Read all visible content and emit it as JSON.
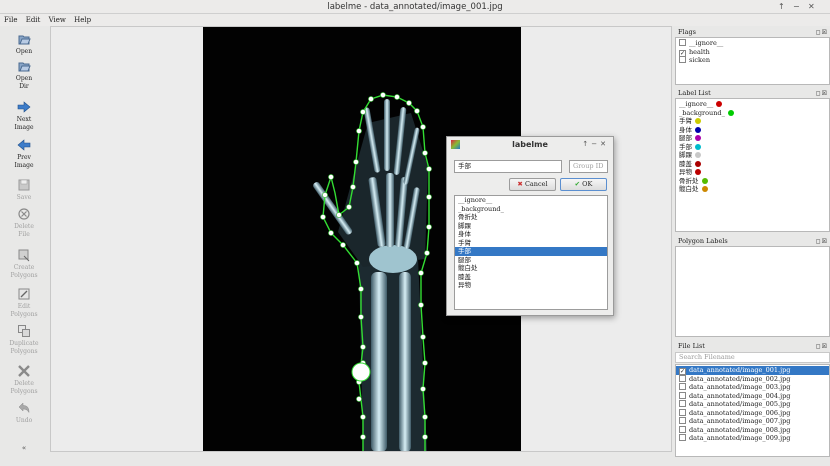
{
  "window": {
    "title": "labelme - data_annotated/image_001.jpg"
  },
  "menu": [
    "File",
    "Edit",
    "View",
    "Help"
  ],
  "tools": [
    {
      "label": "Open",
      "icon": "open-icon",
      "enabled": true
    },
    {
      "label": "Open\nDir",
      "icon": "open-dir-icon",
      "enabled": true
    },
    {
      "label": "Next\nImage",
      "icon": "next-image-icon",
      "enabled": true
    },
    {
      "label": "Prev\nImage",
      "icon": "prev-image-icon",
      "enabled": true
    },
    {
      "label": "Save",
      "icon": "save-icon",
      "enabled": false
    },
    {
      "label": "Delete\nFile",
      "icon": "delete-file-icon",
      "enabled": false
    },
    {
      "label": "Create\nPolygons",
      "icon": "create-polygons-icon",
      "enabled": false
    },
    {
      "label": "Edit\nPolygons",
      "icon": "edit-polygons-icon",
      "enabled": false
    },
    {
      "label": "Duplicate\nPolygons",
      "icon": "duplicate-polygons-icon",
      "enabled": false
    },
    {
      "label": "Delete\nPolygons",
      "icon": "delete-polygons-icon",
      "enabled": false
    },
    {
      "label": "Undo",
      "icon": "undo-icon",
      "enabled": false
    }
  ],
  "flags": {
    "title": "Flags",
    "items": [
      {
        "label": "__ignore__",
        "checked": false
      },
      {
        "label": "health",
        "checked": true
      },
      {
        "label": "sicken",
        "checked": false
      }
    ]
  },
  "label_list": {
    "title": "Label List",
    "items": [
      {
        "label": "__ignore__",
        "color": "#cc0000"
      },
      {
        "label": "_background_",
        "color": "#00cc00"
      },
      {
        "label": "手臂",
        "color": "#cccc00"
      },
      {
        "label": "身体",
        "color": "#0000aa"
      },
      {
        "label": "腿部",
        "color": "#aa00aa"
      },
      {
        "label": "手部",
        "color": "#00bbcc"
      },
      {
        "label": "脚踝",
        "color": "#c8c8c8"
      },
      {
        "label": "膝盖",
        "color": "#aa0000"
      },
      {
        "label": "异物",
        "color": "#bb0000"
      },
      {
        "label": "骨折处",
        "color": "#55bb00"
      },
      {
        "label": "髋白处",
        "color": "#cc8800"
      }
    ]
  },
  "polygon_labels": {
    "title": "Polygon Labels"
  },
  "file_list": {
    "title": "File List",
    "search_placeholder": "Search Filename",
    "items": [
      {
        "name": "data_annotated/image_001.jpg",
        "checked": true,
        "selected": true
      },
      {
        "name": "data_annotated/image_002.jpg",
        "checked": false,
        "selected": false
      },
      {
        "name": "data_annotated/image_003.jpg",
        "checked": false,
        "selected": false
      },
      {
        "name": "data_annotated/image_004.jpg",
        "checked": false,
        "selected": false
      },
      {
        "name": "data_annotated/image_005.jpg",
        "checked": false,
        "selected": false
      },
      {
        "name": "data_annotated/image_006.jpg",
        "checked": false,
        "selected": false
      },
      {
        "name": "data_annotated/image_007.jpg",
        "checked": false,
        "selected": false
      },
      {
        "name": "data_annotated/image_008.jpg",
        "checked": false,
        "selected": false
      },
      {
        "name": "data_annotated/image_009.jpg",
        "checked": false,
        "selected": false
      }
    ]
  },
  "dialog": {
    "title": "labelme",
    "label_value": "手部",
    "group_placeholder": "Group ID",
    "cancel_label": "Cancel",
    "ok_label": "OK",
    "items": [
      "__ignore__",
      "_background_",
      "骨折处",
      "脚踝",
      "身体",
      "手臂",
      "手部",
      "腿部",
      "髋白处",
      "膝盖",
      "异物"
    ],
    "selected_index": 6
  },
  "colors": {
    "polygon": "#33dd33",
    "selection": "#3478c5"
  }
}
